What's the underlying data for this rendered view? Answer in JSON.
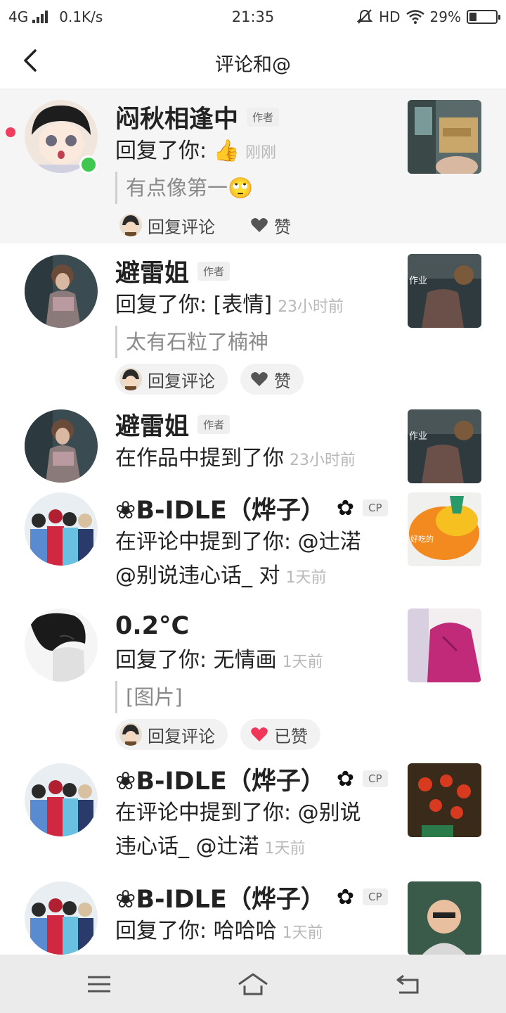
{
  "status": {
    "network": "4G",
    "speed": "0.1K/s",
    "time": "21:35",
    "hd": "HD",
    "battery": "29%",
    "battery_level": 0.29
  },
  "nav": {
    "title": "评论和@"
  },
  "items": [
    {
      "name": "闷秋相逢中",
      "badge": "作者",
      "text": "回复了你: 👍",
      "time": "刚刚",
      "quote": "有点像第一🙄",
      "reply_label": "回复评论",
      "like_label": "赞",
      "liked": false
    },
    {
      "name": "避雷姐",
      "badge": "作者",
      "text": "回复了你: [表情]",
      "time": "23小时前",
      "quote": "太有石粒了楠神",
      "reply_label": "回复评论",
      "like_label": "赞",
      "liked": false
    },
    {
      "name": "避雷姐",
      "badge": "作者",
      "text": "在作品中提到了你",
      "time": "23小时前"
    },
    {
      "name": "❀B-IDLE（烨子）",
      "badge": "CP",
      "text": "在评论中提到了你: @辻渃",
      "text2": "@别说违心话_ 对",
      "time": "1天前"
    },
    {
      "name": "0.2°C",
      "text": "回复了你: 无情画",
      "time": "1天前",
      "quote": "[图片]",
      "reply_label": "回复评论",
      "like_label": "已赞",
      "liked": true
    },
    {
      "name": "❀B-IDLE（烨子）",
      "badge": "CP",
      "text": "在评论中提到了你: @别说",
      "text2": "违心话_ @辻渃",
      "time": "1天前"
    },
    {
      "name": "❀B-IDLE（烨子）",
      "badge": "CP",
      "text": "回复了你: 哈哈哈",
      "time": "1天前"
    }
  ],
  "colors": {
    "unread": "#f03d5f",
    "online": "#3fc74f",
    "liked": "#f0375a",
    "accent_text": "#b8b8b8"
  }
}
